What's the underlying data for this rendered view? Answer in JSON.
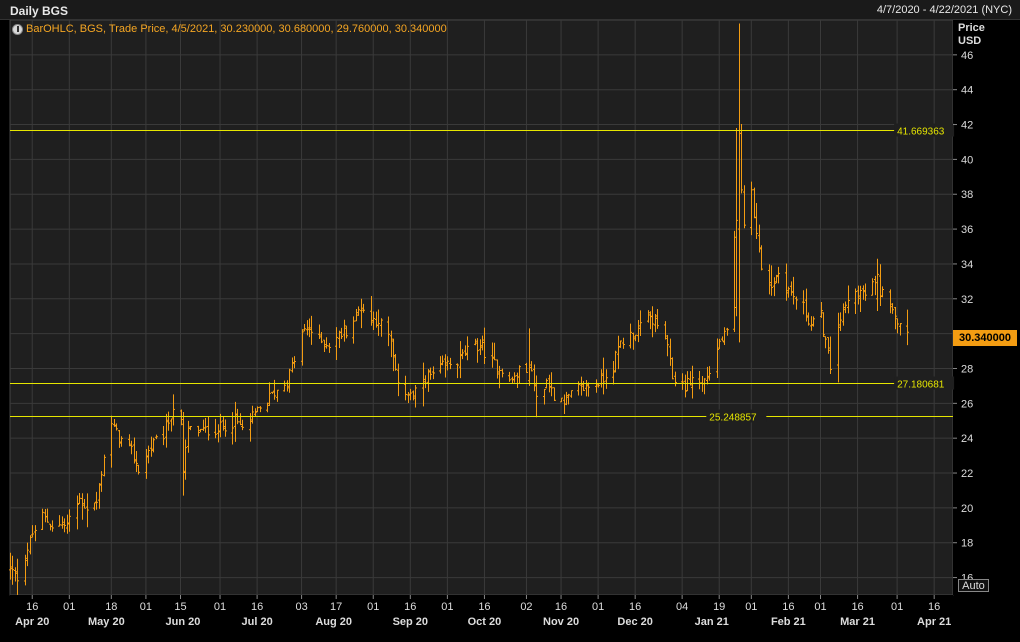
{
  "header": {
    "title": "Daily BGS",
    "range": "4/7/2020 - 4/22/2021 (NYC)"
  },
  "legend": {
    "text": "BarOHLC, BGS, Trade Price, 4/5/2021, 30.230000, 30.680000, 29.760000, 30.340000"
  },
  "axis": {
    "price_title": "Price",
    "currency": "USD",
    "auto_label": "Auto"
  },
  "last_price_label": "30.340000",
  "colors": {
    "bar": "#f39c12",
    "hline": "#e6e600",
    "grid": "#3a3a3a",
    "background": "#1f1f1f"
  },
  "chart_data": {
    "type": "ohlc",
    "series_name": "BGS",
    "ylim": [
      15,
      48
    ],
    "y_ticks": [
      16,
      18,
      20,
      22,
      24,
      26,
      28,
      30,
      32,
      34,
      36,
      38,
      40,
      42,
      44,
      46
    ],
    "x_range": [
      "2020-04-07",
      "2021-04-22"
    ],
    "x_ticks_day": [
      {
        "date": "2020-04-16",
        "label": "16"
      },
      {
        "date": "2020-05-01",
        "label": "01"
      },
      {
        "date": "2020-05-18",
        "label": "18"
      },
      {
        "date": "2020-06-01",
        "label": "01"
      },
      {
        "date": "2020-06-15",
        "label": "15"
      },
      {
        "date": "2020-07-01",
        "label": "01"
      },
      {
        "date": "2020-07-16",
        "label": "16"
      },
      {
        "date": "2020-08-03",
        "label": "03"
      },
      {
        "date": "2020-08-17",
        "label": "17"
      },
      {
        "date": "2020-09-01",
        "label": "01"
      },
      {
        "date": "2020-09-16",
        "label": "16"
      },
      {
        "date": "2020-10-01",
        "label": "01"
      },
      {
        "date": "2020-10-16",
        "label": "16"
      },
      {
        "date": "2020-11-02",
        "label": "02"
      },
      {
        "date": "2020-11-16",
        "label": "16"
      },
      {
        "date": "2020-12-01",
        "label": "01"
      },
      {
        "date": "2020-12-16",
        "label": "16"
      },
      {
        "date": "2021-01-04",
        "label": "04"
      },
      {
        "date": "2021-01-19",
        "label": "19"
      },
      {
        "date": "2021-02-01",
        "label": "01"
      },
      {
        "date": "2021-02-16",
        "label": "16"
      },
      {
        "date": "2021-03-01",
        "label": "01"
      },
      {
        "date": "2021-03-16",
        "label": "16"
      },
      {
        "date": "2021-04-01",
        "label": "01"
      },
      {
        "date": "2021-04-16",
        "label": "16"
      }
    ],
    "x_ticks_month": [
      {
        "date": "2020-04-16",
        "label": "Apr 20"
      },
      {
        "date": "2020-05-16",
        "label": "May 20"
      },
      {
        "date": "2020-06-16",
        "label": "Jun 20"
      },
      {
        "date": "2020-07-16",
        "label": "Jul 20"
      },
      {
        "date": "2020-08-16",
        "label": "Aug 20"
      },
      {
        "date": "2020-09-16",
        "label": "Sep 20"
      },
      {
        "date": "2020-10-16",
        "label": "Oct 20"
      },
      {
        "date": "2020-11-16",
        "label": "Nov 20"
      },
      {
        "date": "2020-12-16",
        "label": "Dec 20"
      },
      {
        "date": "2021-01-16",
        "label": "Jan 21"
      },
      {
        "date": "2021-02-16",
        "label": "Feb 21"
      },
      {
        "date": "2021-03-16",
        "label": "Mar 21"
      },
      {
        "date": "2021-04-16",
        "label": "Apr 21"
      }
    ],
    "horizontal_lines": [
      {
        "value": 41.669363,
        "label": "41.669363",
        "label_at": "2021-04-01"
      },
      {
        "value": 27.180681,
        "label": "27.180681",
        "label_at": "2021-04-01"
      },
      {
        "value": 25.248857,
        "label": "25.248857",
        "label_at": "2021-01-15"
      }
    ],
    "anchors": [
      [
        "2020-04-07",
        16.5
      ],
      [
        "2020-04-10",
        16.0
      ],
      [
        "2020-04-16",
        18.5
      ],
      [
        "2020-04-20",
        19.5
      ],
      [
        "2020-04-24",
        19.0
      ],
      [
        "2020-04-30",
        19.0
      ],
      [
        "2020-05-05",
        20.5
      ],
      [
        "2020-05-08",
        20.0
      ],
      [
        "2020-05-12",
        20.3
      ],
      [
        "2020-05-15",
        23.0
      ],
      [
        "2020-05-18",
        24.8
      ],
      [
        "2020-05-21",
        24.0
      ],
      [
        "2020-05-26",
        23.2
      ],
      [
        "2020-05-29",
        22.2
      ],
      [
        "2020-06-03",
        23.5
      ],
      [
        "2020-06-08",
        24.2
      ],
      [
        "2020-06-12",
        25.8
      ],
      [
        "2020-06-15",
        24.8
      ],
      [
        "2020-06-16",
        22.0
      ],
      [
        "2020-06-18",
        24.5
      ],
      [
        "2020-06-24",
        24.4
      ],
      [
        "2020-07-01",
        24.6
      ],
      [
        "2020-07-07",
        25.0
      ],
      [
        "2020-07-10",
        24.5
      ],
      [
        "2020-07-16",
        25.5
      ],
      [
        "2020-07-22",
        26.5
      ],
      [
        "2020-07-28",
        27.3
      ],
      [
        "2020-07-31",
        28.5
      ],
      [
        "2020-08-03",
        30.0
      ],
      [
        "2020-08-06",
        30.3
      ],
      [
        "2020-08-10",
        29.6
      ],
      [
        "2020-08-14",
        29.4
      ],
      [
        "2020-08-17",
        29.8
      ],
      [
        "2020-08-21",
        30.2
      ],
      [
        "2020-08-25",
        31.0
      ],
      [
        "2020-08-27",
        31.6
      ],
      [
        "2020-08-31",
        30.8
      ],
      [
        "2020-09-03",
        30.8
      ],
      [
        "2020-09-08",
        29.5
      ],
      [
        "2020-09-10",
        27.6
      ],
      [
        "2020-09-14",
        26.7
      ],
      [
        "2020-09-17",
        26.3
      ],
      [
        "2020-09-22",
        27.5
      ],
      [
        "2020-09-25",
        27.6
      ],
      [
        "2020-09-30",
        28.2
      ],
      [
        "2020-10-05",
        28.4
      ],
      [
        "2020-10-09",
        29.0
      ],
      [
        "2020-10-14",
        29.4
      ],
      [
        "2020-10-19",
        28.3
      ],
      [
        "2020-10-23",
        28.0
      ],
      [
        "2020-10-26",
        27.2
      ],
      [
        "2020-10-30",
        27.8
      ],
      [
        "2020-11-03",
        28.2
      ],
      [
        "2020-11-06",
        26.4
      ],
      [
        "2020-11-10",
        27.3
      ],
      [
        "2020-11-13",
        26.5
      ],
      [
        "2020-11-18",
        26.2
      ],
      [
        "2020-11-23",
        26.8
      ],
      [
        "2020-11-27",
        27.0
      ],
      [
        "2020-12-02",
        27.3
      ],
      [
        "2020-12-07",
        28.2
      ],
      [
        "2020-12-10",
        29.5
      ],
      [
        "2020-12-15",
        30.0
      ],
      [
        "2020-12-18",
        30.3
      ],
      [
        "2020-12-21",
        31.0
      ],
      [
        "2020-12-23",
        30.8
      ],
      [
        "2020-12-28",
        29.8
      ],
      [
        "2020-12-31",
        27.5
      ],
      [
        "2021-01-05",
        27.0
      ],
      [
        "2021-01-08",
        27.4
      ],
      [
        "2021-01-12",
        27.1
      ],
      [
        "2021-01-15",
        27.8
      ],
      [
        "2021-01-19",
        29.5
      ],
      [
        "2021-01-22",
        30.0
      ],
      [
        "2021-01-26",
        37.0
      ],
      [
        "2021-01-27",
        40.0
      ],
      [
        "2021-01-28",
        38.0
      ],
      [
        "2021-01-29",
        36.5
      ],
      [
        "2021-02-01",
        38.0
      ],
      [
        "2021-02-03",
        36.0
      ],
      [
        "2021-02-05",
        33.5
      ],
      [
        "2021-02-09",
        32.8
      ],
      [
        "2021-02-12",
        33.5
      ],
      [
        "2021-02-17",
        32.3
      ],
      [
        "2021-02-22",
        31.5
      ],
      [
        "2021-02-25",
        30.5
      ],
      [
        "2021-03-01",
        31.0
      ],
      [
        "2021-03-03",
        29.5
      ],
      [
        "2021-03-05",
        28.0
      ],
      [
        "2021-03-08",
        30.6
      ],
      [
        "2021-03-12",
        31.8
      ],
      [
        "2021-03-16",
        32.5
      ],
      [
        "2021-03-19",
        32.2
      ],
      [
        "2021-03-22",
        32.8
      ],
      [
        "2021-03-25",
        32.4
      ],
      [
        "2021-03-29",
        32.0
      ],
      [
        "2021-04-01",
        30.8
      ],
      [
        "2021-04-05",
        30.3
      ]
    ],
    "spikes": [
      {
        "date": "2021-01-27",
        "high": 47.8,
        "low": 29.5,
        "open": 36.0,
        "close": 41.5
      },
      {
        "date": "2021-01-26",
        "high": 41.8,
        "low": 31.0,
        "open": 31.5,
        "close": 36.5
      },
      {
        "date": "2021-03-08",
        "high": 31.2,
        "low": 27.2,
        "open": 28.2,
        "close": 30.5
      },
      {
        "date": "2021-03-24",
        "high": 34.3,
        "low": 31.3,
        "open": 32.0,
        "close": 33.4
      },
      {
        "date": "2020-06-16",
        "high": 25.5,
        "low": 20.7,
        "open": 24.8,
        "close": 22.1
      },
      {
        "date": "2020-11-03",
        "high": 30.3,
        "low": 27.0,
        "open": 27.3,
        "close": 28.2
      },
      {
        "date": "2020-11-06",
        "high": 27.6,
        "low": 25.2,
        "open": 27.0,
        "close": 26.4
      }
    ]
  }
}
